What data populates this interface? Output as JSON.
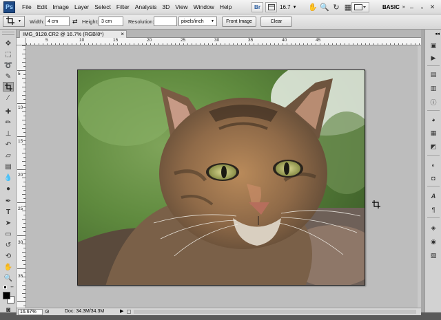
{
  "app": {
    "logo": "Ps"
  },
  "menu": [
    "File",
    "Edit",
    "Image",
    "Layer",
    "Select",
    "Filter",
    "Analysis",
    "3D",
    "View",
    "Window",
    "Help"
  ],
  "menubar_right": {
    "bridge": "Br",
    "zoom": "16.7",
    "workspace": "BASIC"
  },
  "options": {
    "width_label": "Width:",
    "width_value": "4 cm",
    "height_label": "Height:",
    "height_value": "3 cm",
    "resolution_label": "Resolution:",
    "resolution_value": "",
    "resolution_unit": "pixels/inch",
    "front_image_label": "Front Image",
    "clear_label": "Clear"
  },
  "document_tab": {
    "title": "IMG_9128.CR2 @ 16.7% (RGB/8*)",
    "close": "×"
  },
  "ruler_h": [
    "5",
    "10",
    "15",
    "20",
    "25",
    "30",
    "35",
    "40",
    "45"
  ],
  "ruler_v": [
    "5",
    "10",
    "15",
    "20",
    "25",
    "30",
    "35"
  ],
  "status": {
    "zoom": "16.67%",
    "doc": "Doc: 34.3M/34.3M"
  },
  "colors": {
    "foreground": "#000000",
    "background": "#ffffff",
    "ps_blue": "#1e4a86"
  }
}
